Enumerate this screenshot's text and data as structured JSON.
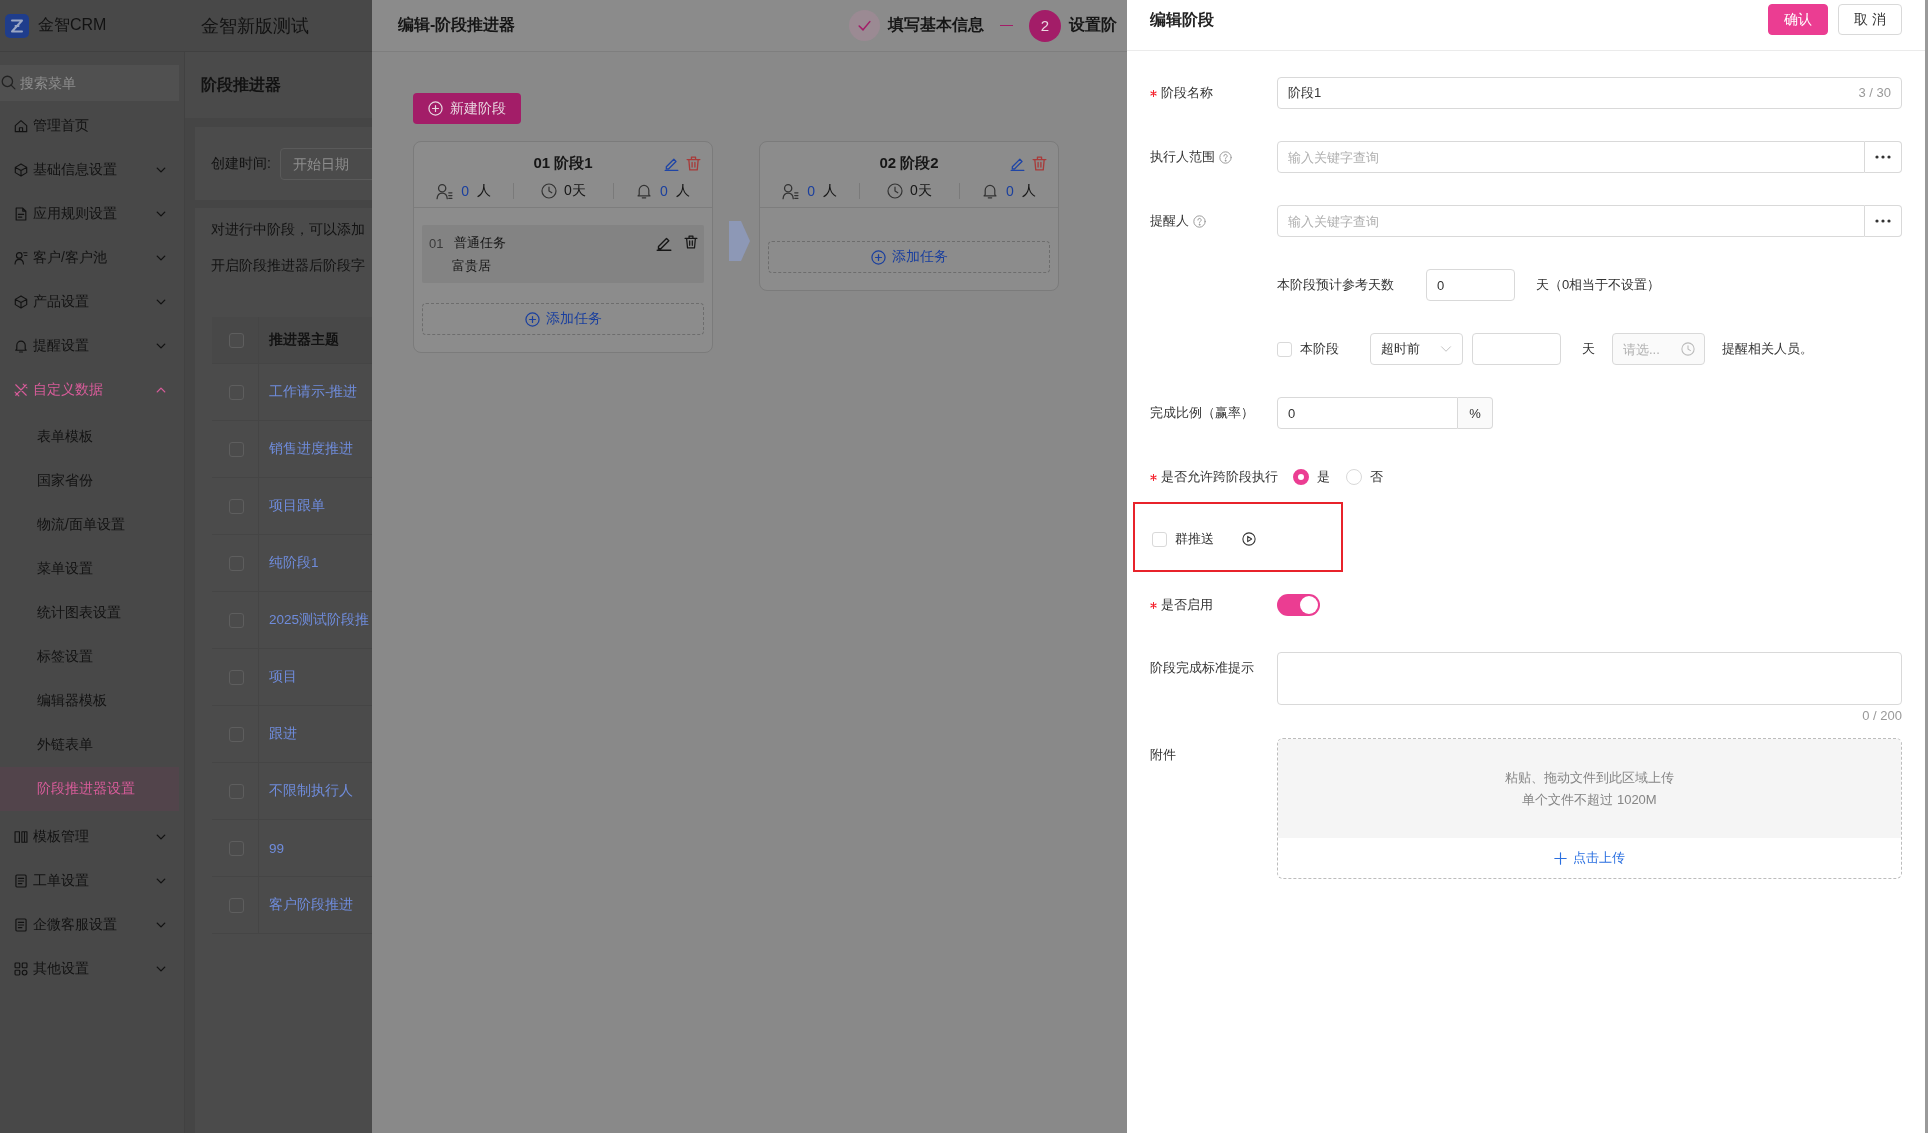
{
  "app": {
    "logo_text": "金智CRM",
    "tenant_title": "金智新版测试"
  },
  "sidebar": {
    "search": {
      "placeholder": "搜索菜单"
    },
    "items": [
      {
        "kind": "page",
        "label": "管理首页",
        "selected": false
      },
      {
        "kind": "group",
        "label": "基础信息设置",
        "selected": false,
        "expanded": false
      },
      {
        "kind": "group",
        "label": "应用规则设置",
        "selected": false,
        "expanded": false
      },
      {
        "kind": "group",
        "label": "客户/客户池",
        "selected": false,
        "expanded": false
      },
      {
        "kind": "group",
        "label": "产品设置",
        "selected": false,
        "expanded": false
      },
      {
        "kind": "group",
        "label": "提醒设置",
        "selected": false,
        "expanded": false
      },
      {
        "kind": "group",
        "label": "自定义数据",
        "selected": true,
        "expanded": true,
        "children": [
          {
            "label": "表单模板",
            "selected": false
          },
          {
            "label": "国家省份",
            "selected": false
          },
          {
            "label": "物流/面单设置",
            "selected": false
          },
          {
            "label": "菜单设置",
            "selected": false
          },
          {
            "label": "统计图表设置",
            "selected": false
          },
          {
            "label": "标签设置",
            "selected": false
          },
          {
            "label": "编辑器模板",
            "selected": false
          },
          {
            "label": "外链表单",
            "selected": false
          },
          {
            "label": "阶段推进器设置",
            "selected": true
          }
        ]
      },
      {
        "kind": "group",
        "label": "模板管理",
        "selected": false,
        "expanded": false
      },
      {
        "kind": "group",
        "label": "工单设置",
        "selected": false,
        "expanded": false
      },
      {
        "kind": "group",
        "label": "企微客服设置",
        "selected": false,
        "expanded": false
      },
      {
        "kind": "group",
        "label": "其他设置",
        "selected": false,
        "expanded": false
      }
    ]
  },
  "page": {
    "title": "阶段推进器",
    "filter": {
      "label": "创建时间:",
      "start_date": {
        "placeholder": "开始日期"
      }
    },
    "notes": [
      "对进行中阶段，可以添加",
      "开启阶段推进器后阶段字"
    ],
    "table": {
      "header_checked": false,
      "columns": [
        "推进器主题"
      ],
      "rows": [
        {
          "checked": false,
          "title": "工作请示-推进"
        },
        {
          "checked": false,
          "title": "销售进度推进"
        },
        {
          "checked": false,
          "title": "项目跟单"
        },
        {
          "checked": false,
          "title": "纯阶段1"
        },
        {
          "checked": false,
          "title": "2025测试阶段推"
        },
        {
          "checked": false,
          "title": "项目"
        },
        {
          "checked": false,
          "title": "跟进"
        },
        {
          "checked": false,
          "title": "不限制执行人"
        },
        {
          "checked": false,
          "title": "99"
        },
        {
          "checked": false,
          "title": "客户阶段推进"
        }
      ]
    }
  },
  "stage_editor": {
    "title": "编辑-阶段推进器",
    "steps": [
      {
        "done": true,
        "label": "填写基本信息"
      },
      {
        "done": false,
        "number": "2",
        "label": "设置阶"
      }
    ],
    "new_stage_button": "新建阶段",
    "stages": [
      {
        "title": "01 阶段1",
        "executors": "0",
        "executors_unit": "人",
        "days": "0天",
        "reminders": "0",
        "reminders_unit": "人",
        "tasks": [
          {
            "number": "01",
            "type": "普通任务",
            "name": "富贵居"
          }
        ],
        "add_task": "添加任务"
      },
      {
        "title": "02 阶段2",
        "executors": "0",
        "executors_unit": "人",
        "days": "0天",
        "reminders": "0",
        "reminders_unit": "人",
        "add_task": "添加任务"
      }
    ]
  },
  "stage_form": {
    "title": "编辑阶段",
    "buttons": [
      {
        "kind": "primary",
        "label": "确认"
      },
      {
        "kind": "default",
        "label": "取 消"
      }
    ],
    "name": {
      "label": "阶段名称",
      "required": true,
      "value": "阶段1",
      "counter": "3 / 30"
    },
    "executor_scope": {
      "label": "执行人范围",
      "placeholder": "输入关键字查询"
    },
    "reminder_person": {
      "label": "提醒人",
      "placeholder": "输入关键字查询"
    },
    "expected_days": {
      "label": "本阶段预计参考天数",
      "value": "0",
      "suffix": "天（0相当于不设置）"
    },
    "reminder_rule": {
      "checked": false,
      "label": "本阶段",
      "timing": "超时前",
      "unit": "天",
      "time": {
        "placeholder": "请选..."
      },
      "suffix": "提醒相关人员。"
    },
    "completion_rate": {
      "label": "完成比例（赢率）",
      "value": "0",
      "suffix": "%"
    },
    "allow_skip": {
      "label": "是否允许跨阶段执行",
      "required": true,
      "options": [
        {
          "label": "是",
          "selected": true
        },
        {
          "label": "否",
          "selected": false
        }
      ]
    },
    "group_push": {
      "label": "群推送",
      "checked": false,
      "highlighted": true
    },
    "enabled": {
      "label": "是否启用",
      "required": true,
      "on": true
    },
    "completion_hint": {
      "label": "阶段完成标准提示",
      "counter": "0 / 200"
    },
    "attachment": {
      "label": "附件",
      "hints": [
        "粘贴、拖动文件到此区域上传",
        "单个文件不超过 1020M"
      ],
      "upload_link": "点击上传"
    }
  }
}
